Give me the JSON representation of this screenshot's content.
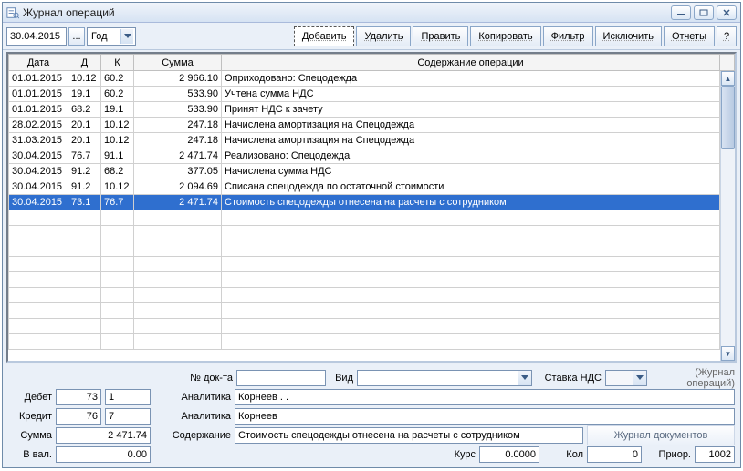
{
  "window": {
    "title": "Журнал операций"
  },
  "toolbar": {
    "date": "30.04.2015",
    "period": "Год",
    "add": "Добавить",
    "del": "Удалить",
    "edit": "Править",
    "copy": "Копировать",
    "filter": "Фильтр",
    "exclude": "Исключить",
    "reports": "Отчеты",
    "help": "?"
  },
  "grid": {
    "headers": {
      "date": "Дата",
      "d": "Д",
      "k": "К",
      "sum": "Сумма",
      "desc": "Содержание операции"
    },
    "rows": [
      {
        "date": "01.01.2015",
        "d": "10.12",
        "k": "60.2",
        "sum": "2 966.10",
        "desc": "Оприходовано: Спецодежда"
      },
      {
        "date": "01.01.2015",
        "d": "19.1",
        "k": "60.2",
        "sum": "533.90",
        "desc": "Учтена сумма НДС"
      },
      {
        "date": "01.01.2015",
        "d": "68.2",
        "k": "19.1",
        "sum": "533.90",
        "desc": "Принят НДС к зачету"
      },
      {
        "date": "28.02.2015",
        "d": "20.1",
        "k": "10.12",
        "sum": "247.18",
        "desc": "Начислена амортизация на Спецодежда"
      },
      {
        "date": "31.03.2015",
        "d": "20.1",
        "k": "10.12",
        "sum": "247.18",
        "desc": "Начислена амортизация на Спецодежда"
      },
      {
        "date": "30.04.2015",
        "d": "76.7",
        "k": "91.1",
        "sum": "2 471.74",
        "desc": "Реализовано: Спецодежда"
      },
      {
        "date": "30.04.2015",
        "d": "91.2",
        "k": "68.2",
        "sum": "377.05",
        "desc": "Начислена сумма НДС"
      },
      {
        "date": "30.04.2015",
        "d": "91.2",
        "k": "10.12",
        "sum": "2 094.69",
        "desc": "Списана спецодежда по остаточной стоимости"
      },
      {
        "date": "30.04.2015",
        "d": "73.1",
        "k": "76.7",
        "sum": "2 471.74",
        "desc": "Стоимость спецодежды отнесена на расчеты с сотрудником"
      }
    ],
    "selected_index": 8,
    "empty_rows": 9
  },
  "bottom": {
    "docno_label": "№ док-та",
    "docno": "",
    "vid_label": "Вид",
    "vid": "",
    "vat_label": "Ставка НДС",
    "vat": "",
    "source": "(Журнал операций)",
    "debet_label": "Дебет",
    "debet_acc": "73",
    "debet_sub": "1",
    "kredit_label": "Кредит",
    "kredit_acc": "76",
    "kredit_sub": "7",
    "analytic_label": "Аналитика",
    "analytic1": "Корнеев . .",
    "analytic2": "Корнеев",
    "sum_label": "Сумма",
    "sum": "2 471.74",
    "content_label": "Содержание",
    "content": "Стоимость спецодежды отнесена на расчеты с сотрудником",
    "docjournal_btn": "Журнал документов",
    "inval_label": "В вал.",
    "inval": "0.00",
    "rate_label": "Курс",
    "rate": "0.0000",
    "qty_label": "Кол",
    "qty": "0",
    "prior_label": "Приор.",
    "prior": "1002"
  }
}
